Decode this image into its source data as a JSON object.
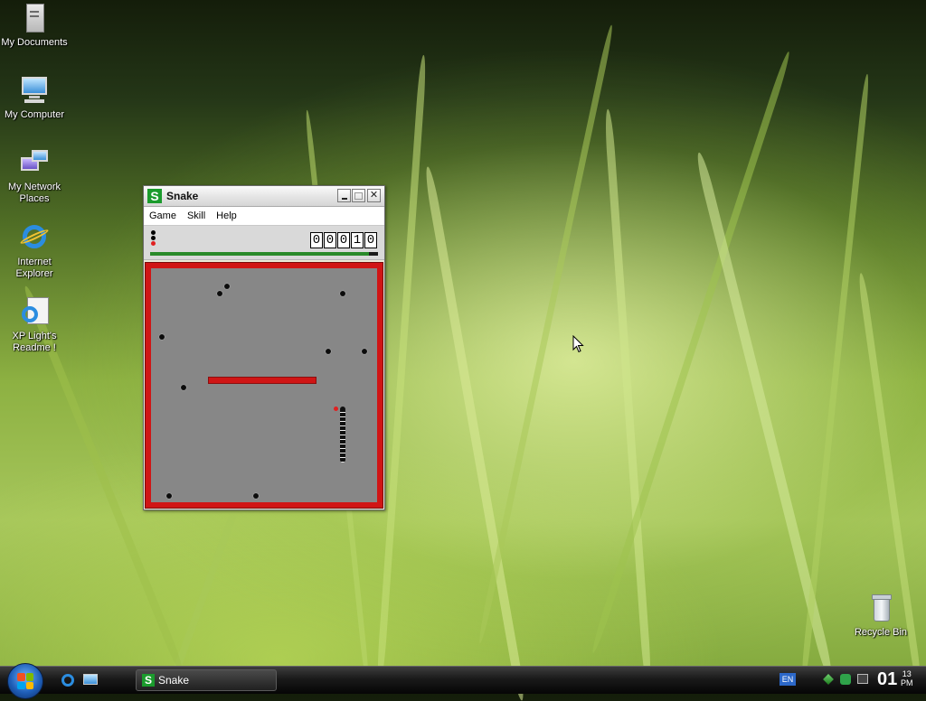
{
  "desktop": {
    "icons": [
      {
        "label": "My Documents",
        "icon": "folder-documents-icon"
      },
      {
        "label": "My Computer",
        "icon": "computer-icon"
      },
      {
        "label": "My Network Places",
        "icon": "network-icon"
      },
      {
        "label": "Internet Explorer",
        "icon": "internet-explorer-icon"
      },
      {
        "label": "XP Light's Readme !",
        "icon": "readme-icon"
      },
      {
        "label": "Recycle Bin",
        "icon": "recycle-bin-icon"
      }
    ]
  },
  "window": {
    "title": "Snake",
    "app_icon_letter": "S",
    "menu": [
      "Game",
      "Skill",
      "Help"
    ],
    "score_digits": [
      "0",
      "0",
      "0",
      "1",
      "0"
    ],
    "progress_fraction": 0.96,
    "lives": 3
  },
  "taskbar": {
    "task_label": "Snake",
    "language": "EN",
    "clock_hour": "01",
    "clock_minute": "13",
    "clock_ampm": "PM"
  },
  "colors": {
    "field_border": "#d01515",
    "field_bg": "#878787",
    "app_icon_green": "#1b9b2d"
  }
}
